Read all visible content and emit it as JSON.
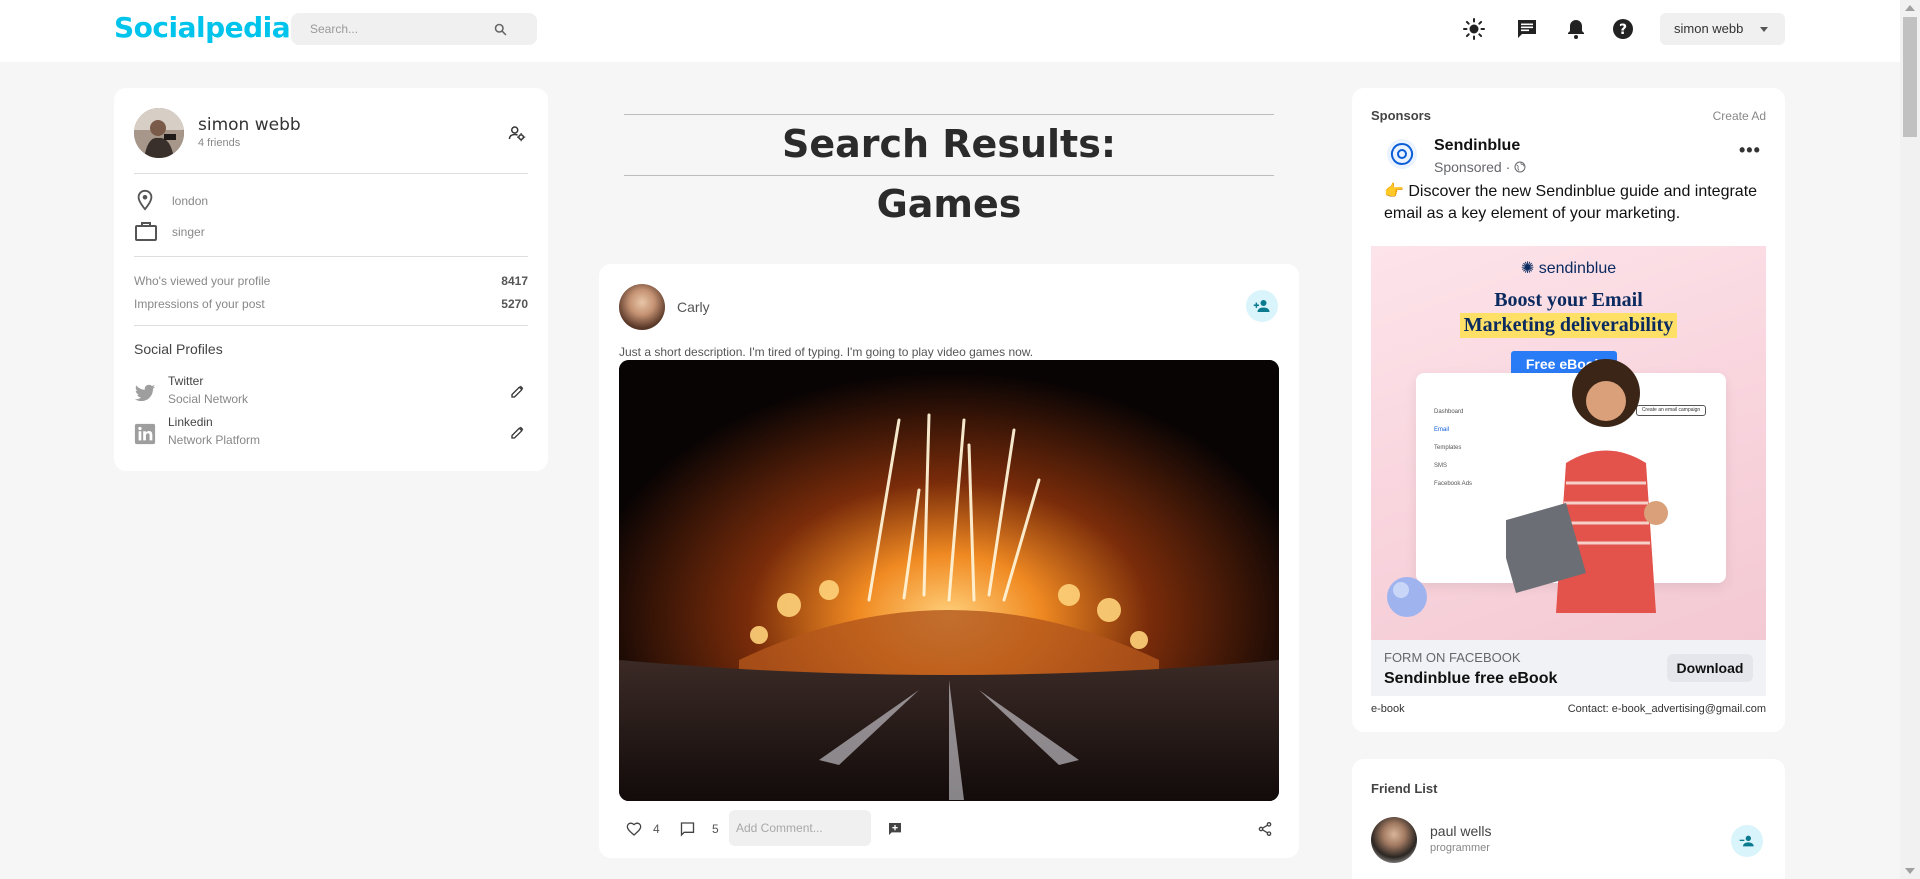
{
  "navbar": {
    "logo": "Socialpedia",
    "search_placeholder": "Search...",
    "user_name": "simon webb"
  },
  "profile": {
    "name": "simon webb",
    "friends": "4 friends",
    "location": "london",
    "occupation": "singer",
    "stats": [
      {
        "label": "Who's viewed your profile",
        "value": "8417"
      },
      {
        "label": "Impressions of your post",
        "value": "5270"
      }
    ],
    "social_title": "Social Profiles",
    "socials": [
      {
        "name": "Twitter",
        "desc": "Social Network"
      },
      {
        "name": "Linkedin",
        "desc": "Network Platform"
      }
    ]
  },
  "results": {
    "line1": "Search Results:",
    "line2": "Games"
  },
  "post": {
    "author": "Carly",
    "description": "Just a short description. I'm tired of typing. I'm going to play video games now.",
    "likes": "4",
    "comments": "5",
    "comment_placeholder": "Add Comment..."
  },
  "sponsors": {
    "title": "Sponsors",
    "create_ad": "Create Ad",
    "ad": {
      "brand": "Sendinblue",
      "sponsored": "Sponsored · ",
      "text": "👉 Discover the new Sendinblue guide and integrate email as a key element of your marketing.",
      "image_brand": "sendinblue",
      "image_headline_1": "Boost your Email",
      "image_headline_2": "Marketing deliverability",
      "image_badge": "Free eBook",
      "mock_items": [
        "Dashboard",
        "Email",
        "Templates",
        "SMS",
        "Facebook Ads"
      ],
      "mock_button": "Create an email campaign",
      "form_label": "FORM ON FACEBOOK",
      "form_title": "Sendinblue free eBook",
      "download": "Download",
      "meta_left": "e-book",
      "meta_right": "Contact: e-book_advertising@gmail.com"
    }
  },
  "friend_list": {
    "title": "Friend List",
    "friends": [
      {
        "name": "paul wells",
        "job": "programmer"
      }
    ]
  },
  "colors": {
    "brand": "#00c4ec",
    "accent_bg": "#d9f4fb",
    "page_bg": "#f6f6f6"
  }
}
